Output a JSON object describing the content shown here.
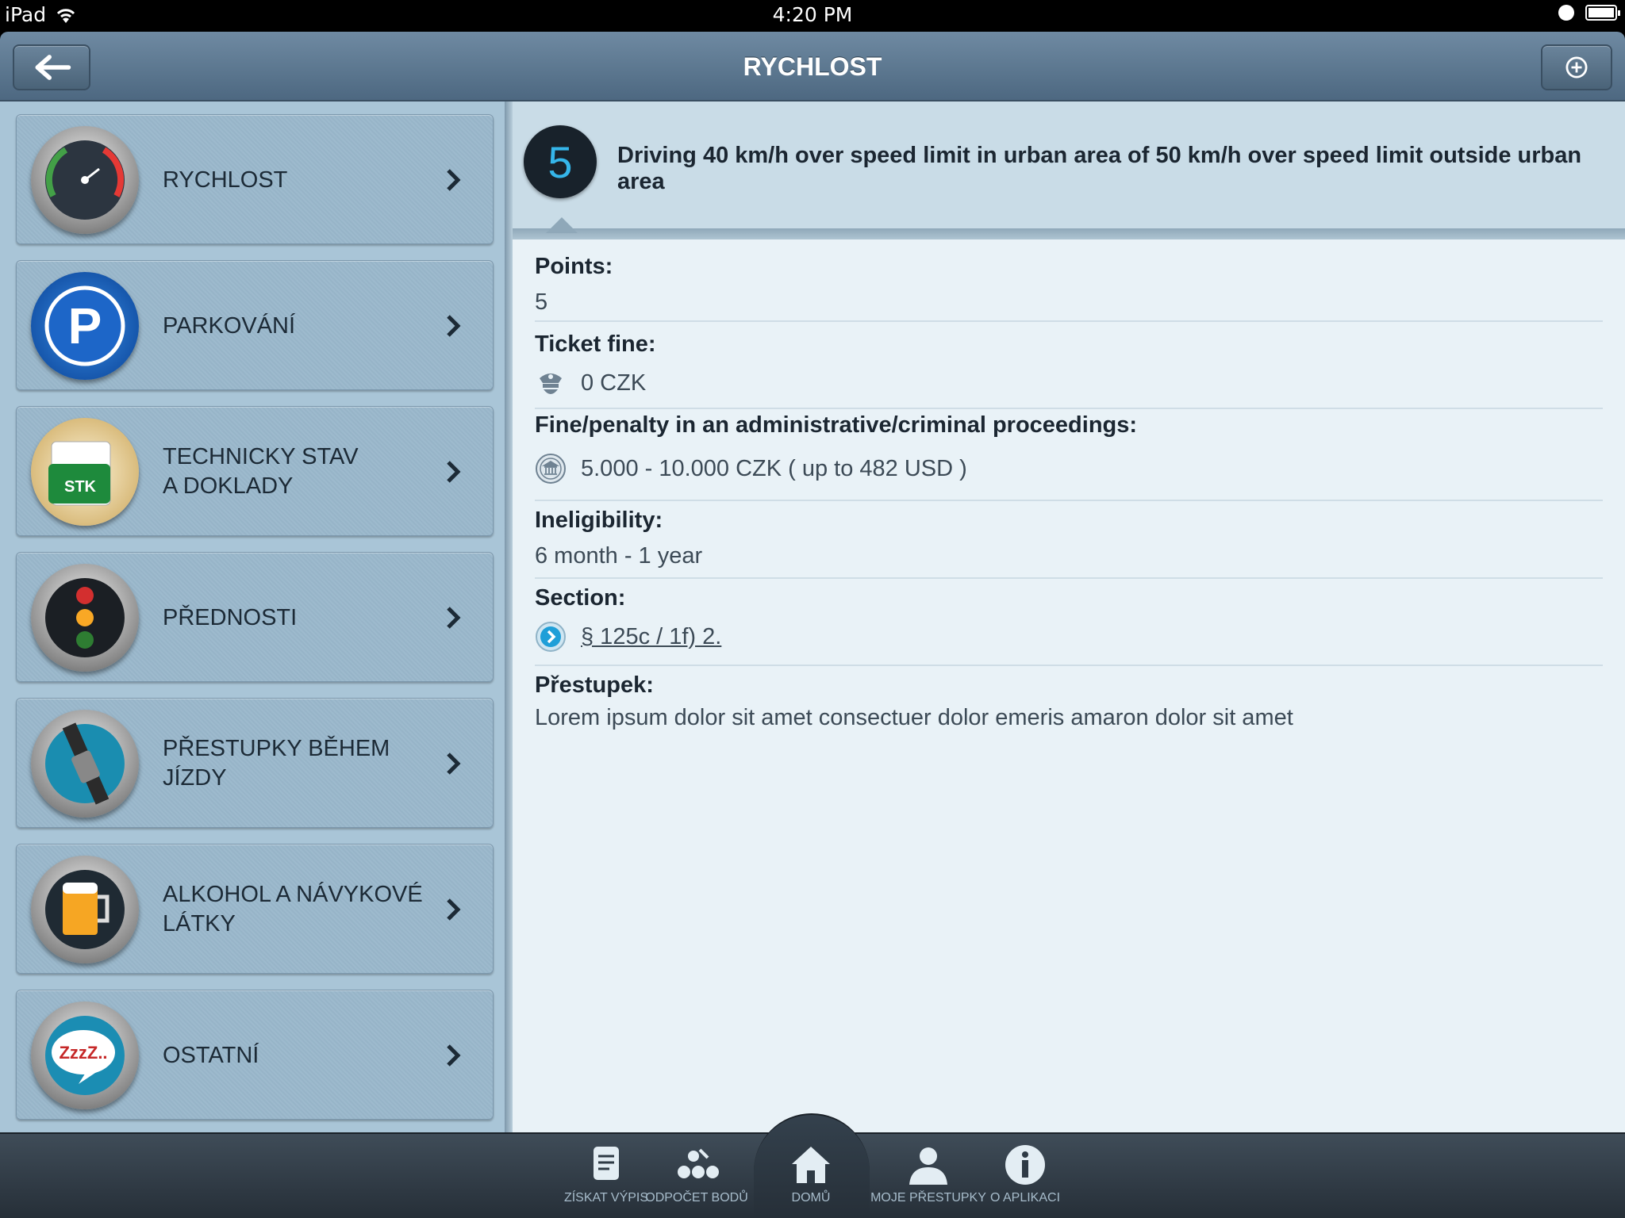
{
  "status_bar": {
    "device": "iPad",
    "time": "4:20 PM"
  },
  "nav": {
    "title": "RYCHLOST"
  },
  "categories": [
    {
      "label": "RYCHLOST",
      "icon": "speedometer-icon"
    },
    {
      "label": "PARKOVÁNÍ",
      "icon": "parking-icon"
    },
    {
      "label": "TECHNICKY STAV\nA DOKLADY",
      "icon": "stk-document-icon",
      "badge": "STK"
    },
    {
      "label": "PŘEDNOSTI",
      "icon": "traffic-light-icon"
    },
    {
      "label": "PŘESTUPKY BĚHEM JÍZDY",
      "icon": "seatbelt-icon"
    },
    {
      "label": "ALKOHOL A NÁVYKOVÉ\nLÁTKY",
      "icon": "beer-icon"
    },
    {
      "label": "OSTATNÍ",
      "icon": "sleep-icon",
      "badge": "ZzzZ.."
    }
  ],
  "detail": {
    "points_badge": "5",
    "title": "Driving 40 km/h over speed limit in urban area of 50 km/h over speed limit outside urban area",
    "fields": {
      "points": {
        "label": "Points:",
        "value": "5"
      },
      "ticket_fine": {
        "label": "Ticket fine:",
        "value": "0 CZK"
      },
      "admin_fine": {
        "label": "Fine/penalty in an administrative/criminal proceedings:",
        "value": "5.000 - 10.000 CZK ( up to 482 USD )"
      },
      "ineligibility": {
        "label": "Ineligibility:",
        "value": "6 month - 1 year"
      },
      "section": {
        "label": "Section:",
        "value": "§ 125c / 1f) 2."
      },
      "prestupek": {
        "label": "Přestupek:",
        "value": "Lorem ipsum dolor sit amet consectuer dolor emeris amaron dolor sit amet"
      }
    }
  },
  "tabbar": [
    {
      "label": "ZÍSKAT VÝPIS",
      "icon": "document-icon"
    },
    {
      "label": "ODPOČET BODŮ",
      "icon": "points-dots-icon"
    },
    {
      "label": "DOMŮ",
      "icon": "home-icon"
    },
    {
      "label": "MOJE PŘESTUPKY",
      "icon": "user-icon"
    },
    {
      "label": "O APLIKACI",
      "icon": "info-icon"
    }
  ],
  "colors": {
    "accent": "#35b6ea",
    "nav": "#5a7590",
    "list_bg": "#9dbacd",
    "detail_bg": "#e9f2f7"
  }
}
